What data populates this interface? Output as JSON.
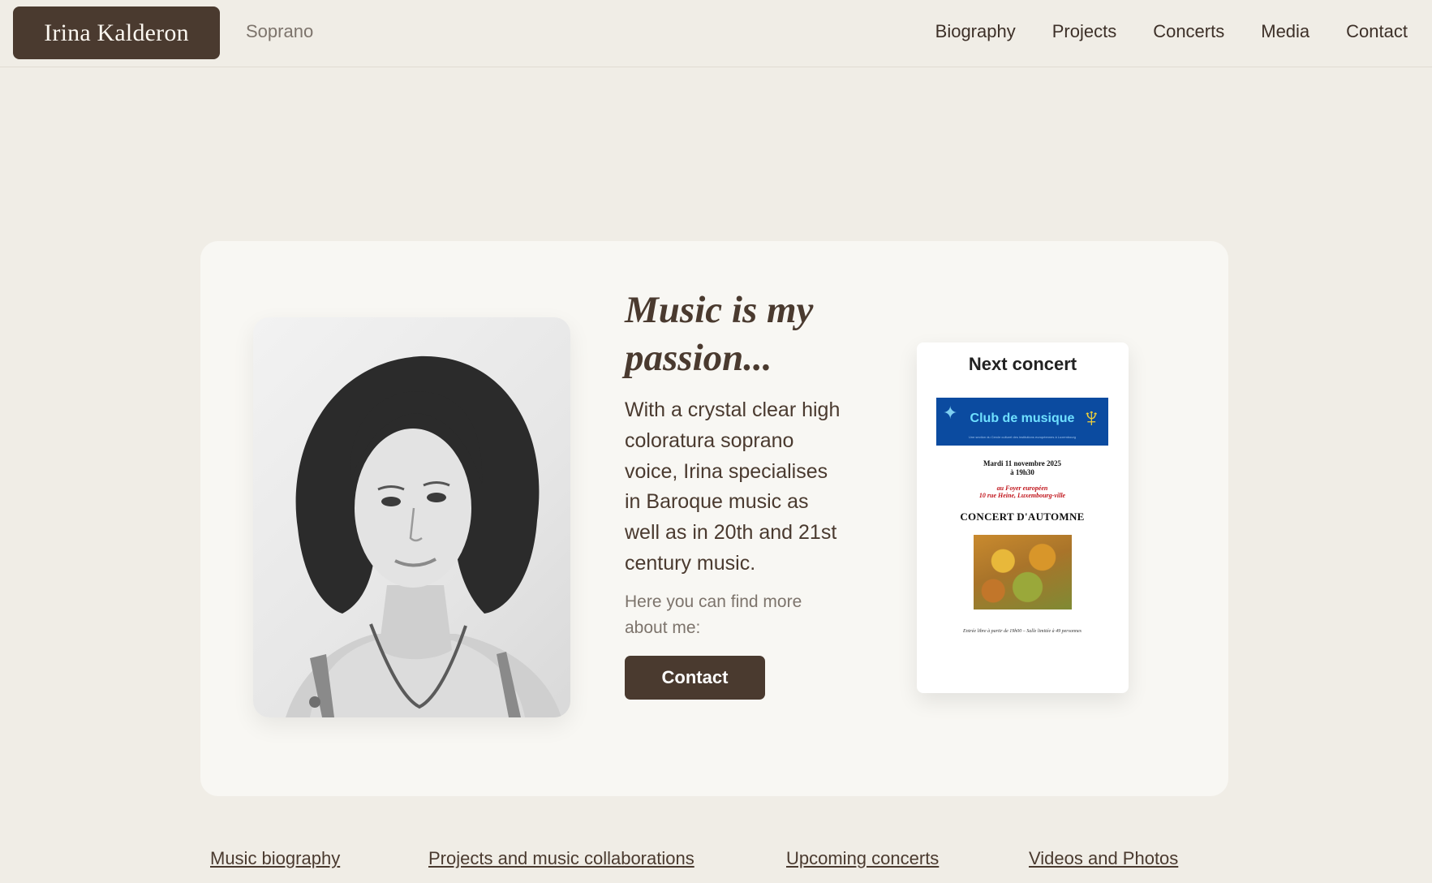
{
  "header": {
    "brand": "Irina Kalderon",
    "tagline": "Soprano",
    "nav": [
      "Biography",
      "Projects",
      "Concerts",
      "Media",
      "Contact"
    ]
  },
  "hero": {
    "headline_line1": "Music is my",
    "headline_line2": "passion...",
    "body": "With a crystal clear high coloratura soprano voice, Irina specialises in Baroque music as well as in 20th and 21st century music.",
    "find_more": "Here you can find more about me:",
    "contact_button": "Contact"
  },
  "concert": {
    "title": "Next concert",
    "flyer": {
      "banner_title": "Club de musique",
      "banner_subtitle": "Une section du Cercle culturel des institutions européennes à Luxembourg",
      "date": "Mardi 11 novembre 2025",
      "time": "à 19h30",
      "venue_line1": "au Foyer européen",
      "venue_line2": "10 rue Heine, Luxembourg-ville",
      "event": "CONCERT D'AUTOMNE",
      "footer": "Entrée libre à partir de 19h00 – Salle limitée à 49 personnes"
    }
  },
  "bottom_links": [
    "Music biography",
    "Projects and music collaborations",
    "Upcoming concerts",
    "Videos and Photos"
  ],
  "colors": {
    "page_bg": "#f0ede6",
    "card_bg": "#f8f7f3",
    "accent": "#4a3a2f",
    "muted": "#7d746c"
  }
}
